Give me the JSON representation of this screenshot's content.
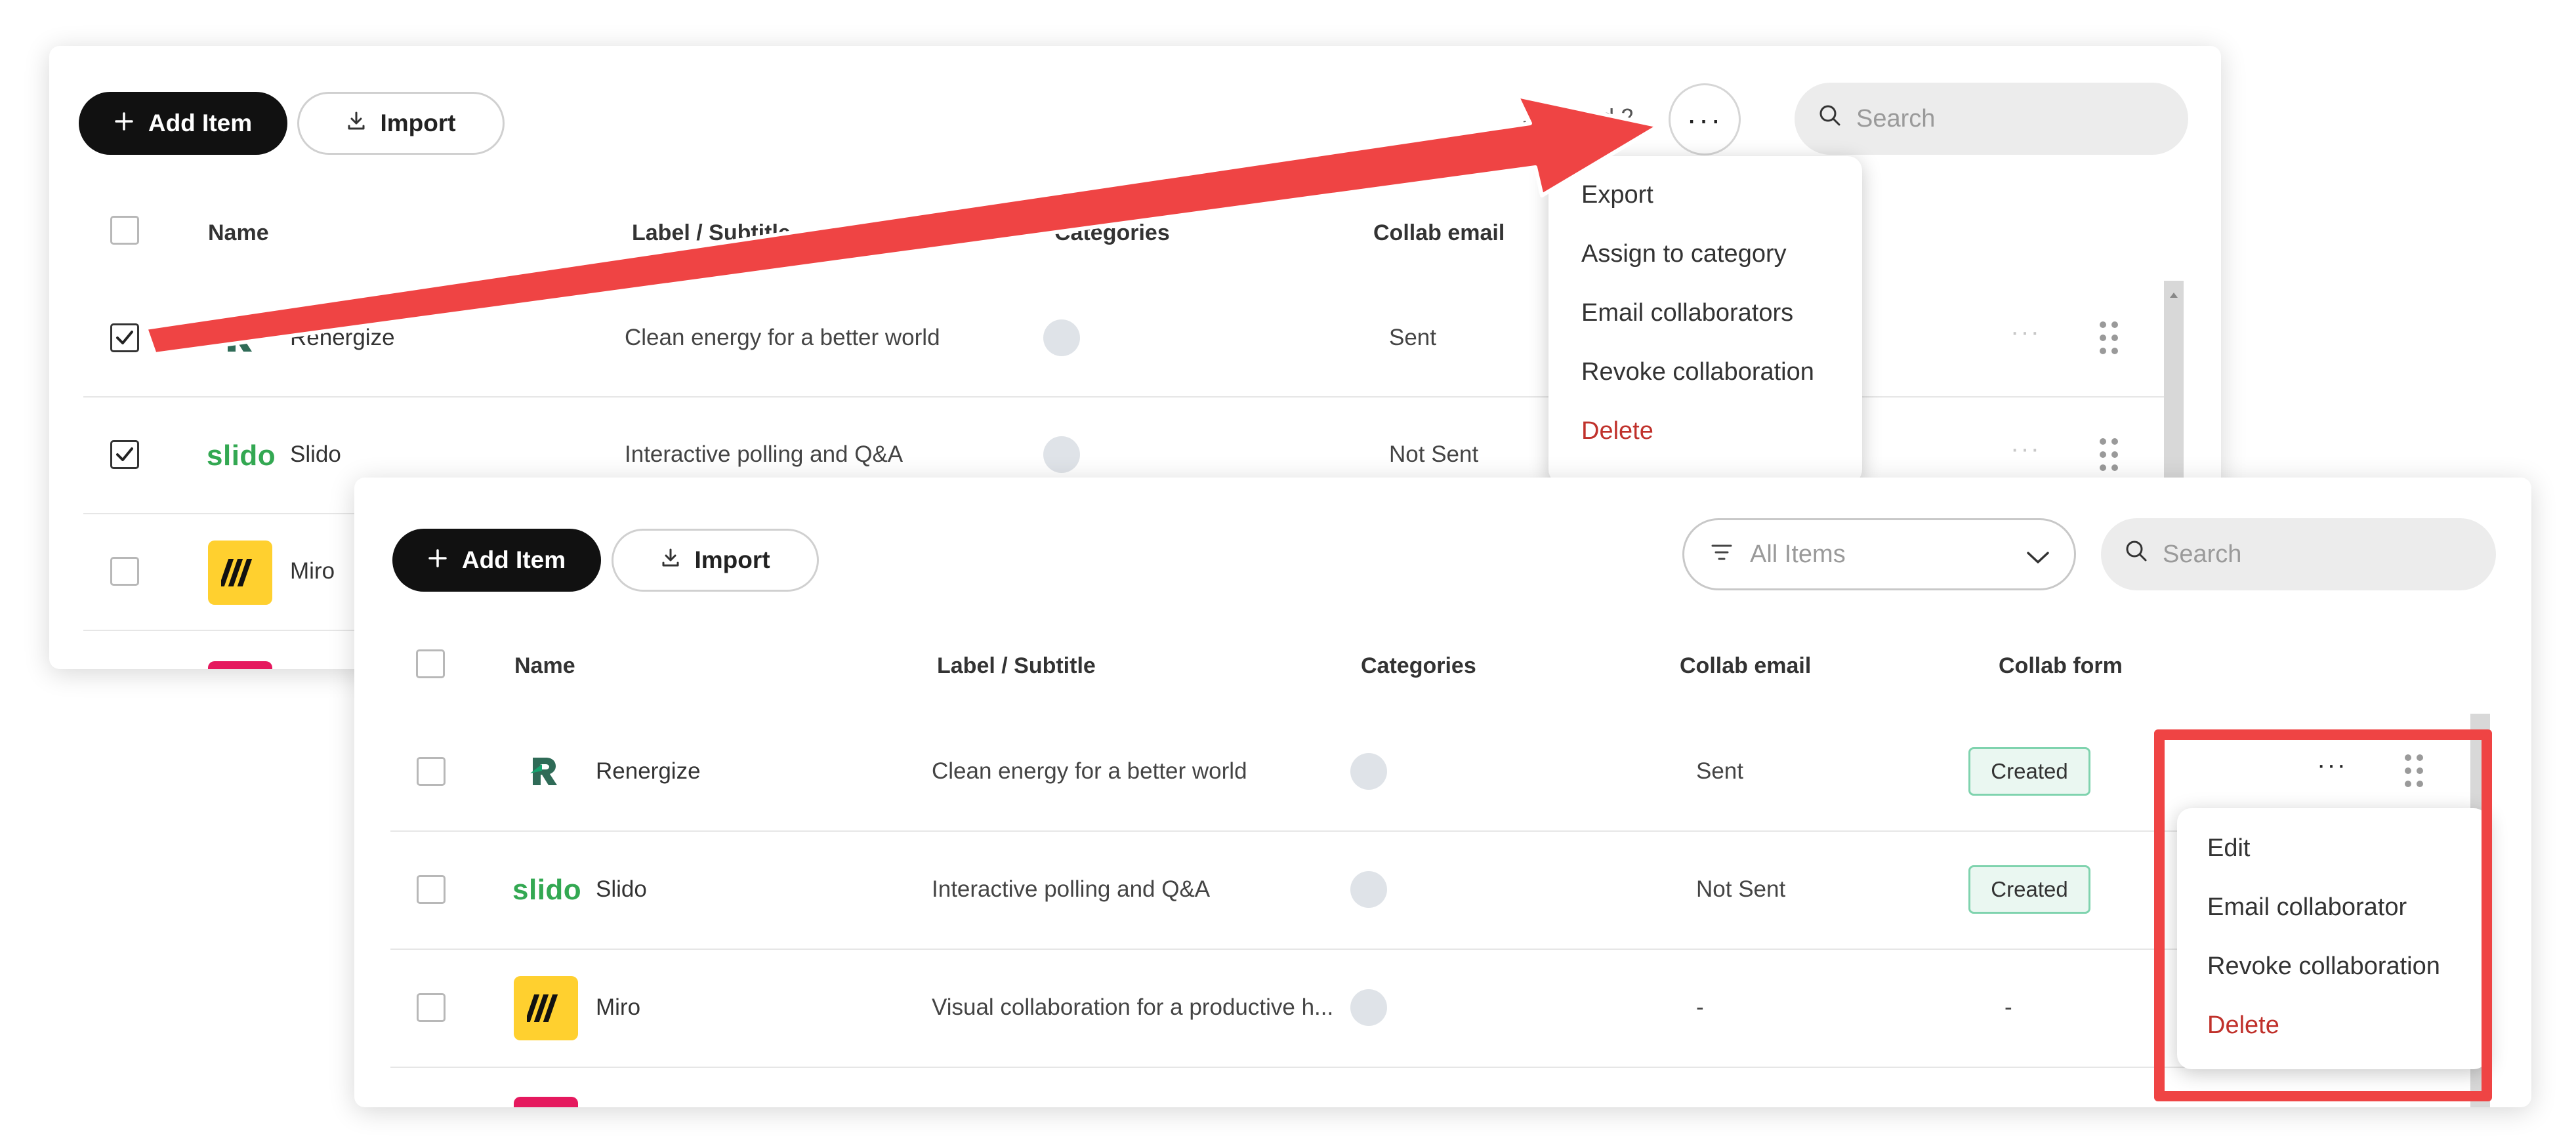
{
  "back_panel": {
    "toolbar": {
      "add_item_label": "Add Item",
      "import_label": "Import",
      "selected_text": "Selected 2",
      "more_button": "···",
      "search_placeholder": "Search"
    },
    "columns": [
      "Name",
      "Label / Subtitle",
      "Categories",
      "Collab email"
    ],
    "rows": [
      {
        "name": "Renergize",
        "subtitle": "Clean energy for a better world",
        "collab_email": "Sent",
        "checked": true
      },
      {
        "name": "Slido",
        "subtitle": "Interactive polling and Q&A",
        "collab_email": "Not Sent",
        "checked": true
      },
      {
        "name": "Miro",
        "subtitle": "",
        "collab_email": "",
        "checked": false
      }
    ],
    "bulk_menu": [
      "Export",
      "Assign to category",
      "Email collaborators",
      "Revoke collaboration",
      "Delete"
    ],
    "row_more": "···"
  },
  "front_panel": {
    "toolbar": {
      "add_item_label": "Add Item",
      "import_label": "Import",
      "filter_label": "All Items",
      "search_placeholder": "Search"
    },
    "columns": [
      "Name",
      "Label / Subtitle",
      "Categories",
      "Collab email",
      "Collab form"
    ],
    "rows": [
      {
        "name": "Renergize",
        "subtitle": "Clean energy for a better world",
        "collab_email": "Sent",
        "collab_form": "Created"
      },
      {
        "name": "Slido",
        "subtitle": "Interactive polling and Q&A",
        "collab_email": "Not Sent",
        "collab_form": "Created"
      },
      {
        "name": "Miro",
        "subtitle": "Visual collaboration for a productive h...",
        "collab_email": "-",
        "collab_form": "-"
      }
    ],
    "row_menu": [
      "Edit",
      "Email collaborator",
      "Revoke collaboration",
      "Delete"
    ],
    "row_more": "···"
  },
  "logos": {
    "slido": "slido"
  },
  "colors": {
    "primary_button": "#111111",
    "badge_bg": "#eaf7f1",
    "badge_border": "#7fd3ae",
    "danger": "#c0312b",
    "annotation_red": "#ef4444",
    "slido_green": "#33a852",
    "miro_yellow": "#ffd02f"
  }
}
